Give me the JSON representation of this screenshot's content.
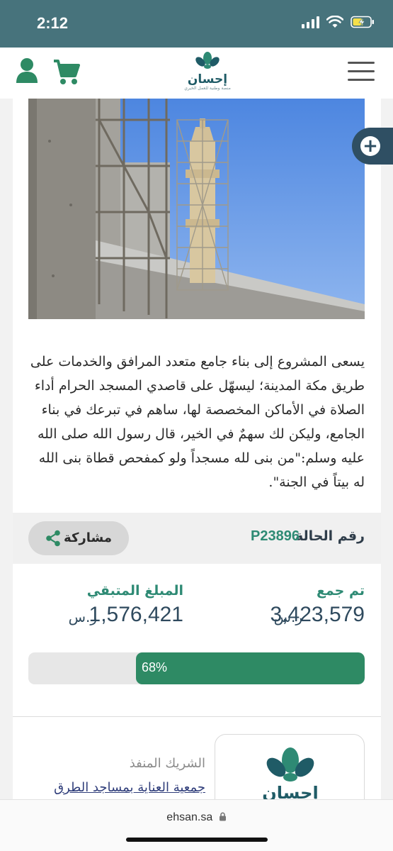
{
  "status_bar": {
    "time": "2:12"
  },
  "header": {
    "logo_text": "إحسان",
    "logo_subtitle": "منصة وطنية للعمل الخيري"
  },
  "project": {
    "description": "يسعى المشروع إلى بناء جامع متعدد المرافق والخدمات على طريق مكة المدينة؛ ليسهّل على قاصدي المسجد الحرام أداء الصلاة في الأماكن المخصصة لها، ساهم في تبرعك في بناء الجامع، وليكن لك سهمٌ في الخير، قال رسول الله صلى الله عليه وسلم:\"من بنى لله مسجداً ولو كمفحص قطاة بنى الله له بيتاً في الجنة\"."
  },
  "case": {
    "label": "رقم الحالة",
    "number": "P23896",
    "share_label": "مشاركة"
  },
  "funding": {
    "collected_label": "تم جمع",
    "collected_value": "3,423,579",
    "remaining_label": "المبلغ المتبقي",
    "remaining_value": "1,576,421",
    "currency": "ر.س",
    "progress_text": "68%",
    "progress_fraction": 0.68
  },
  "partner": {
    "label": "الشريك المنفذ",
    "name": "جمعية العناية بمساجد الطرق",
    "logo_text": "إحسان"
  },
  "browser": {
    "url": "ehsan.sa"
  },
  "colors": {
    "status_bar": "#47737c",
    "brand_green": "#2e8a64",
    "brand_dark": "#1f5b66",
    "accent_navy": "#2f4a5e"
  }
}
